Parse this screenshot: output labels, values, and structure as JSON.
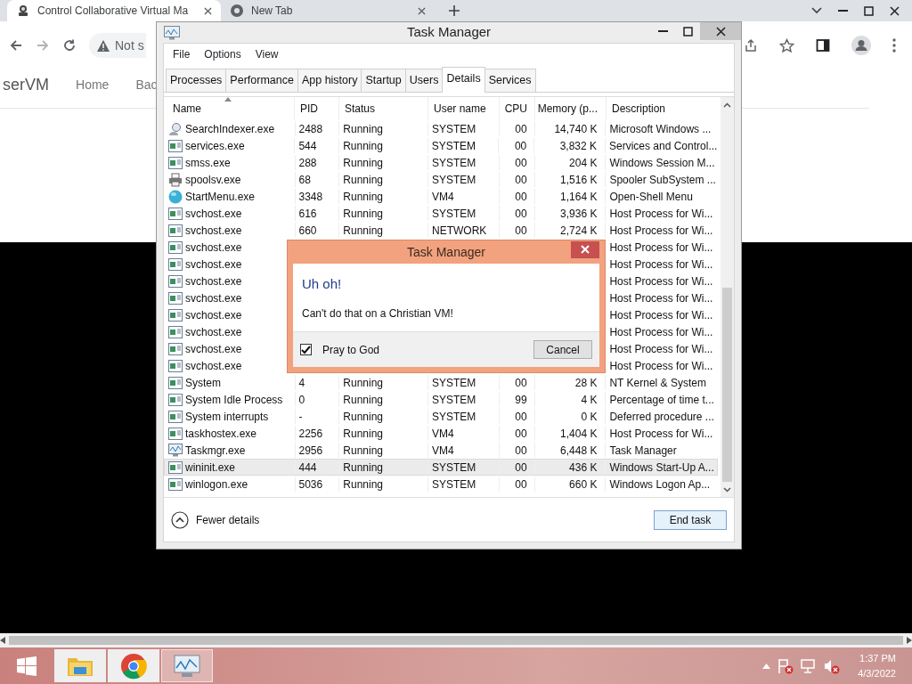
{
  "browser": {
    "tabs": [
      {
        "title": "Control Collaborative Virtual Ma",
        "selected": true,
        "kind": "site"
      },
      {
        "title": "New Tab",
        "selected": false,
        "kind": "newtab"
      }
    ],
    "address": "Not s",
    "page": {
      "brand": "serVM",
      "nav": [
        "Home",
        "Bac"
      ]
    }
  },
  "task_manager": {
    "title": "Task Manager",
    "menu": [
      "File",
      "Options",
      "View"
    ],
    "tabs": [
      {
        "label": "Processes",
        "selected": false
      },
      {
        "label": "Performance",
        "selected": false
      },
      {
        "label": "App history",
        "selected": false
      },
      {
        "label": "Startup",
        "selected": false
      },
      {
        "label": "Users",
        "selected": false
      },
      {
        "label": "Details",
        "selected": true
      },
      {
        "label": "Services",
        "selected": false
      }
    ],
    "columns": [
      "Name",
      "PID",
      "Status",
      "User name",
      "CPU",
      "Memory (p...",
      "Description"
    ],
    "rows": [
      {
        "kind": "search",
        "name": "SearchIndexer.exe",
        "pid": "2488",
        "status": "Running",
        "user": "SYSTEM",
        "cpu": "00",
        "memory": "14,740 K",
        "description": "Microsoft Windows ...",
        "selected": false
      },
      {
        "kind": "app",
        "name": "services.exe",
        "pid": "544",
        "status": "Running",
        "user": "SYSTEM",
        "cpu": "00",
        "memory": "3,832 K",
        "description": "Services and Control...",
        "selected": false
      },
      {
        "kind": "app",
        "name": "smss.exe",
        "pid": "288",
        "status": "Running",
        "user": "SYSTEM",
        "cpu": "00",
        "memory": "204 K",
        "description": "Windows Session M...",
        "selected": false
      },
      {
        "kind": "printer",
        "name": "spoolsv.exe",
        "pid": "68",
        "status": "Running",
        "user": "SYSTEM",
        "cpu": "00",
        "memory": "1,516 K",
        "description": "Spooler SubSystem ...",
        "selected": false
      },
      {
        "kind": "globe",
        "name": "StartMenu.exe",
        "pid": "3348",
        "status": "Running",
        "user": "VM4",
        "cpu": "00",
        "memory": "1,164 K",
        "description": "Open-Shell Menu",
        "selected": false
      },
      {
        "kind": "app",
        "name": "svchost.exe",
        "pid": "616",
        "status": "Running",
        "user": "SYSTEM",
        "cpu": "00",
        "memory": "3,936 K",
        "description": "Host Process for Wi...",
        "selected": false
      },
      {
        "kind": "app",
        "name": "svchost.exe",
        "pid": "660",
        "status": "Running",
        "user": "NETWORK",
        "cpu": "00",
        "memory": "2,724 K",
        "description": "Host Process for Wi...",
        "selected": false
      },
      {
        "kind": "app",
        "name": "svchost.exe",
        "description": "Host Process for Wi...",
        "selected": false
      },
      {
        "kind": "app",
        "name": "svchost.exe",
        "description": "Host Process for Wi...",
        "selected": false
      },
      {
        "kind": "app",
        "name": "svchost.exe",
        "description": "Host Process for Wi...",
        "selected": false
      },
      {
        "kind": "app",
        "name": "svchost.exe",
        "description": "Host Process for Wi...",
        "selected": false
      },
      {
        "kind": "app",
        "name": "svchost.exe",
        "description": "Host Process for Wi...",
        "selected": false
      },
      {
        "kind": "app",
        "name": "svchost.exe",
        "description": "Host Process for Wi...",
        "selected": false
      },
      {
        "kind": "app",
        "name": "svchost.exe",
        "description": "Host Process for Wi...",
        "selected": false
      },
      {
        "kind": "app",
        "name": "svchost.exe",
        "description": "Host Process for Wi...",
        "selected": false
      },
      {
        "kind": "app",
        "name": "System",
        "pid": "4",
        "status": "Running",
        "user": "SYSTEM",
        "cpu": "00",
        "memory": "28 K",
        "description": "NT Kernel & System",
        "selected": false
      },
      {
        "kind": "app",
        "name": "System Idle Process",
        "pid": "0",
        "status": "Running",
        "user": "SYSTEM",
        "cpu": "99",
        "memory": "4 K",
        "description": "Percentage of time t...",
        "selected": false
      },
      {
        "kind": "app",
        "name": "System interrupts",
        "pid": "-",
        "status": "Running",
        "user": "SYSTEM",
        "cpu": "00",
        "memory": "0 K",
        "description": "Deferred procedure ...",
        "selected": false
      },
      {
        "kind": "app",
        "name": "taskhostex.exe",
        "pid": "2256",
        "status": "Running",
        "user": "VM4",
        "cpu": "00",
        "memory": "1,404 K",
        "description": "Host Process for Wi...",
        "selected": false
      },
      {
        "kind": "taskmgr",
        "name": "Taskmgr.exe",
        "pid": "2956",
        "status": "Running",
        "user": "VM4",
        "cpu": "00",
        "memory": "6,448 K",
        "description": "Task Manager",
        "selected": false
      },
      {
        "kind": "app",
        "name": "wininit.exe",
        "pid": "444",
        "status": "Running",
        "user": "SYSTEM",
        "cpu": "00",
        "memory": "436 K",
        "description": "Windows Start-Up A...",
        "selected": true
      },
      {
        "kind": "app",
        "name": "winlogon.exe",
        "pid": "5036",
        "status": "Running",
        "user": "SYSTEM",
        "cpu": "00",
        "memory": "660 K",
        "description": "Windows Logon Ap...",
        "selected": false
      }
    ],
    "fewer_details": "Fewer details",
    "end_task": "End task"
  },
  "dialog": {
    "title": "Task Manager",
    "heading": "Uh oh!",
    "message": "Can't do that on a Christian VM!",
    "checkbox": {
      "label": "Pray to God",
      "checked": true
    },
    "button": "Cancel"
  },
  "taskbar": {
    "apps": [
      {
        "kind": "explorer",
        "selected": false
      },
      {
        "kind": "chrome",
        "selected": false
      },
      {
        "kind": "taskmgr",
        "selected": true
      }
    ],
    "time": "1:37 PM",
    "date": "4/3/2022"
  }
}
